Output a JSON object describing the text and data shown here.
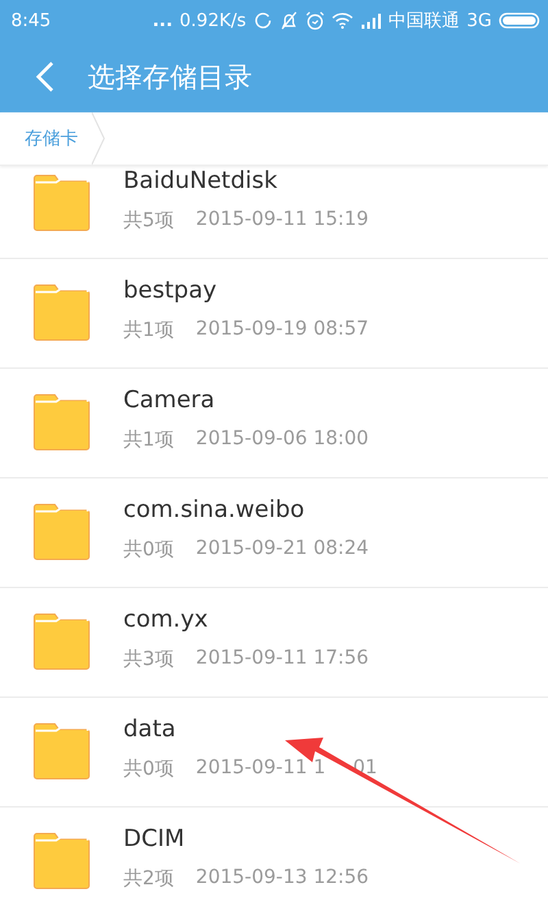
{
  "status_bar": {
    "time": "8:45",
    "dots": "...",
    "speed": "0.92K/s",
    "carrier": "中国联通",
    "network": "3G"
  },
  "header": {
    "title": "选择存储目录"
  },
  "breadcrumb": [
    {
      "label": "存储卡"
    }
  ],
  "folders": [
    {
      "name": "BaiduNetdisk",
      "count": "共5项",
      "date": "2015-09-11 15:19"
    },
    {
      "name": "bestpay",
      "count": "共1项",
      "date": "2015-09-19 08:57"
    },
    {
      "name": "Camera",
      "count": "共1项",
      "date": "2015-09-06 18:00"
    },
    {
      "name": "com.sina.weibo",
      "count": "共0项",
      "date": "2015-09-21 08:24"
    },
    {
      "name": "com.yx",
      "count": "共3项",
      "date": "2015-09-11 17:56"
    },
    {
      "name": "data",
      "count": "共0项",
      "date": "2015-09-11 1",
      "date_tail": "01"
    },
    {
      "name": "DCIM",
      "count": "共2项",
      "date": "2015-09-13 12:56"
    }
  ]
}
